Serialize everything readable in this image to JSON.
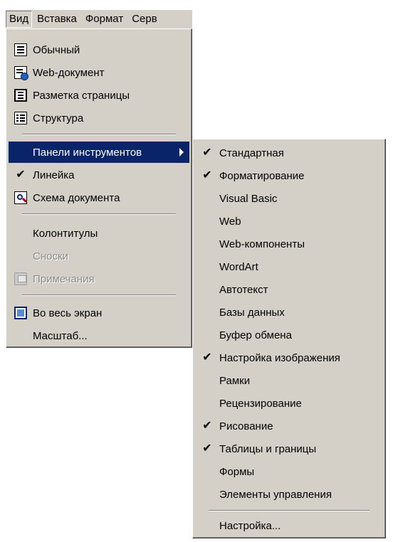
{
  "menubar": {
    "items": [
      {
        "label": "Вид"
      },
      {
        "label": "Вставка"
      },
      {
        "label": "Формат"
      },
      {
        "label": "Серв"
      }
    ]
  },
  "view_menu": {
    "items": [
      {
        "label": "Обычный",
        "icon": "normal-view-icon"
      },
      {
        "label": "Web-документ",
        "icon": "web-document-icon"
      },
      {
        "label": "Разметка страницы",
        "icon": "page-layout-icon"
      },
      {
        "label": "Структура",
        "icon": "outline-icon"
      },
      {
        "label": "Панели инструментов",
        "submenu": true
      },
      {
        "label": "Линейка",
        "checked": true
      },
      {
        "label": "Схема документа",
        "icon": "document-map-icon"
      },
      {
        "label": "Колонтитулы"
      },
      {
        "label": "Сноски",
        "disabled": true
      },
      {
        "label": "Примечания",
        "disabled": true,
        "icon": "comments-icon"
      },
      {
        "label": "Во весь экран",
        "icon": "full-screen-icon"
      },
      {
        "label": "Масштаб..."
      }
    ]
  },
  "toolbars_submenu": {
    "items": [
      {
        "label": "Стандартная",
        "checked": true
      },
      {
        "label": "Форматирование",
        "checked": true
      },
      {
        "label": "Visual Basic",
        "checked": false
      },
      {
        "label": "Web",
        "checked": false
      },
      {
        "label": "Web-компоненты",
        "checked": false
      },
      {
        "label": "WordArt",
        "checked": false
      },
      {
        "label": "Автотекст",
        "checked": false
      },
      {
        "label": "Базы данных",
        "checked": false
      },
      {
        "label": "Буфер обмена",
        "checked": false
      },
      {
        "label": "Настройка изображения",
        "checked": true
      },
      {
        "label": "Рамки",
        "checked": false
      },
      {
        "label": "Рецензирование",
        "checked": false
      },
      {
        "label": "Рисование",
        "checked": true
      },
      {
        "label": "Таблицы и границы",
        "checked": true
      },
      {
        "label": "Формы",
        "checked": false
      },
      {
        "label": "Элементы управления",
        "checked": false
      },
      {
        "label": "Настройка..."
      }
    ]
  },
  "check_glyph": "✔",
  "colors": {
    "menu_bg": "#d4d0c8",
    "highlight": "#0a246a",
    "disabled_text": "#8a8a8a"
  }
}
